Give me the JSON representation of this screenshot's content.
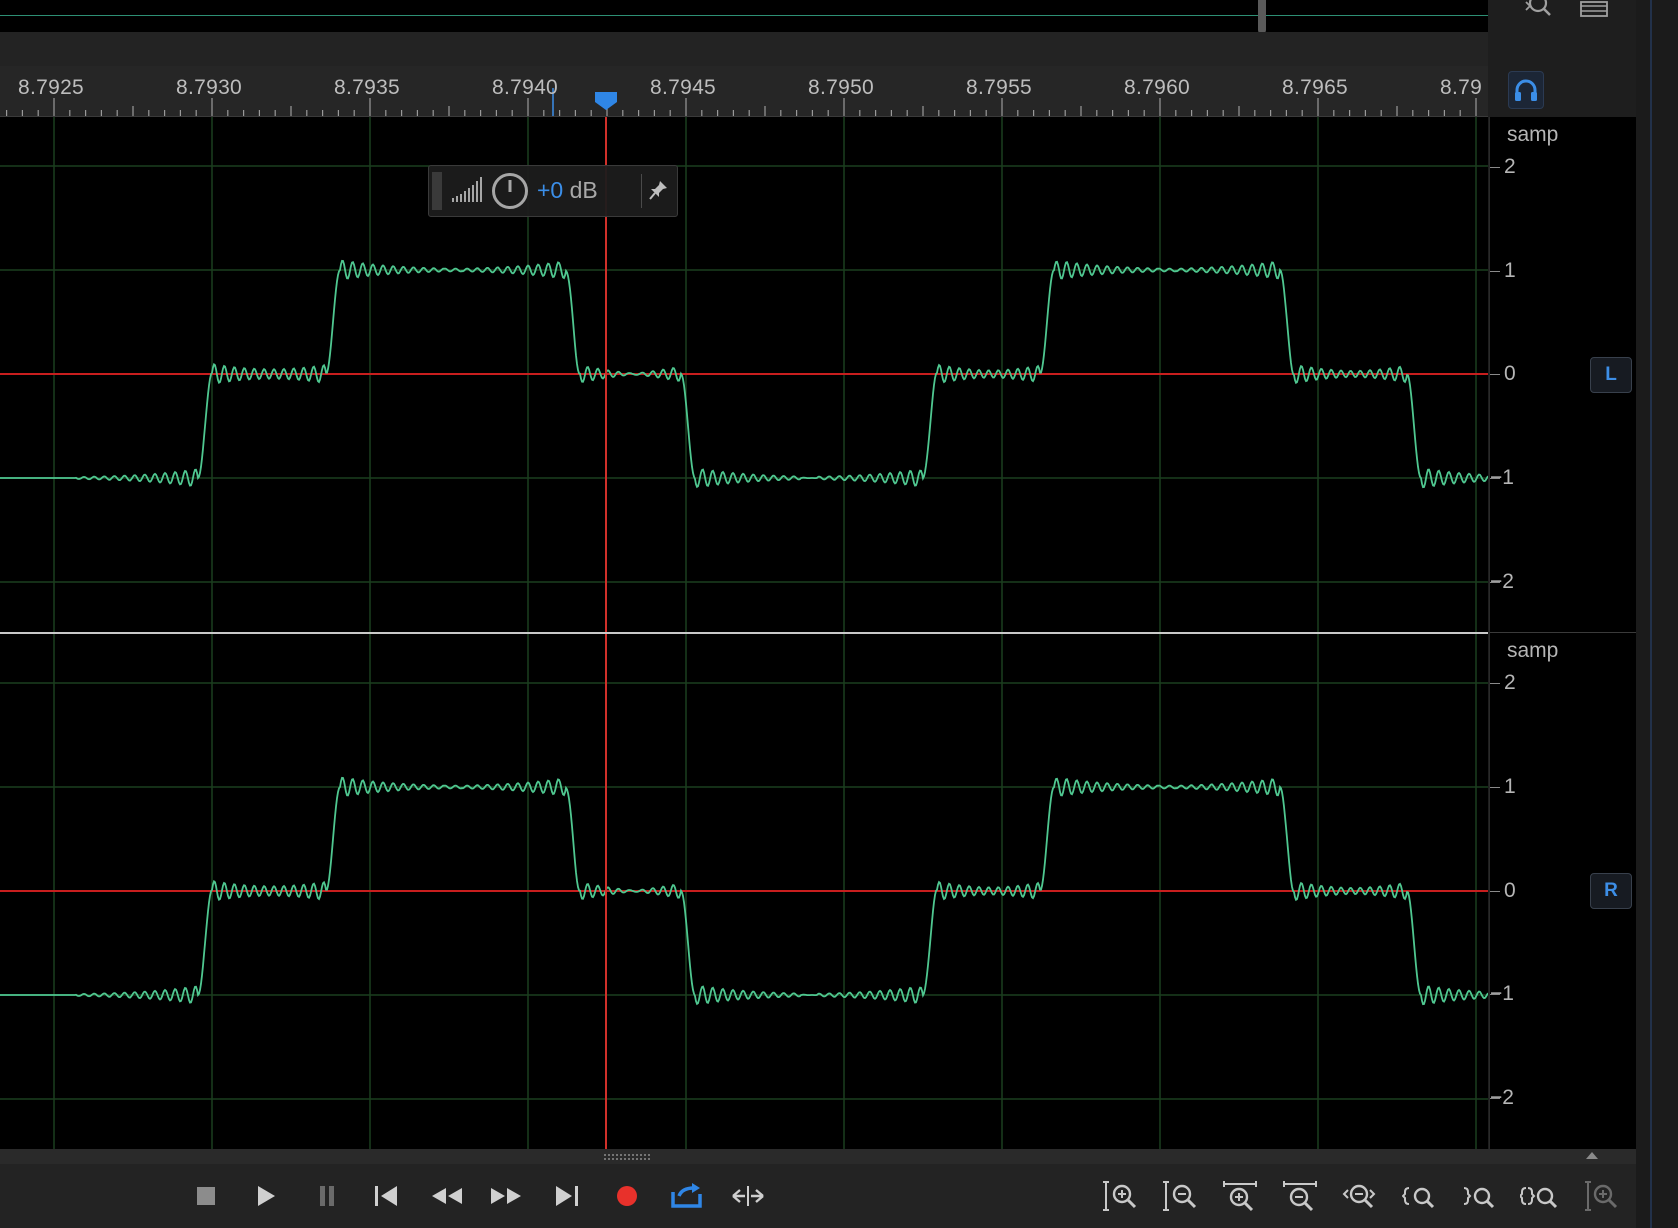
{
  "ruler": {
    "ticks": [
      "8.7925",
      "8.7930",
      "8.7935",
      "8.7940",
      "8.7945",
      "8.7950",
      "8.7955",
      "8.7960",
      "8.7965",
      "8.79"
    ]
  },
  "channels": [
    {
      "id": "L",
      "label": "L",
      "unit": "samp",
      "scale": [
        "2",
        "1",
        "0",
        "−1",
        "−2"
      ]
    },
    {
      "id": "R",
      "label": "R",
      "unit": "samp",
      "scale": [
        "2",
        "1",
        "0",
        "−1",
        "−2"
      ]
    }
  ],
  "hud": {
    "gain_value": "+0",
    "gain_unit": "dB"
  },
  "colors": {
    "waveform": "#4fc790",
    "playhead": "#d0302a",
    "zero_line": "#c81e1e",
    "grid": "#1b3f1f",
    "accent": "#3b8ee8"
  },
  "transport": {
    "buttons": [
      "stop",
      "play",
      "pause",
      "go-to-start",
      "rewind",
      "fast-forward",
      "go-to-end",
      "record",
      "loop",
      "skip-selection"
    ]
  },
  "zoom_tools": [
    "zoom-in-amplitude",
    "zoom-out-amplitude",
    "zoom-in-time",
    "zoom-out-time",
    "zoom-out-full",
    "zoom-to-selection",
    "zoom-selection-right",
    "zoom-selection-both",
    "zoom-in-playhead"
  ]
}
